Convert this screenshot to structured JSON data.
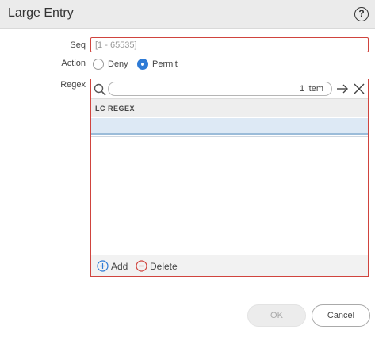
{
  "dialog": {
    "title": "Large Entry",
    "help_icon": "?"
  },
  "form": {
    "seq_label": "Seq",
    "seq_placeholder": "[1 - 65535]",
    "action_label": "Action",
    "action_options": [
      {
        "label": "Deny",
        "checked": false
      },
      {
        "label": "Permit",
        "checked": true
      }
    ],
    "regex_label": "Regex"
  },
  "regex_table": {
    "item_count": "1 item",
    "column_header": "LC REGEX",
    "rows": [
      ""
    ],
    "add_label": "Add",
    "delete_label": "Delete"
  },
  "buttons": {
    "ok_label": "OK",
    "cancel_label": "Cancel"
  },
  "colors": {
    "error_border": "#d0443e",
    "accent": "#2e7bd6",
    "selected_row": "#dde9f5"
  }
}
